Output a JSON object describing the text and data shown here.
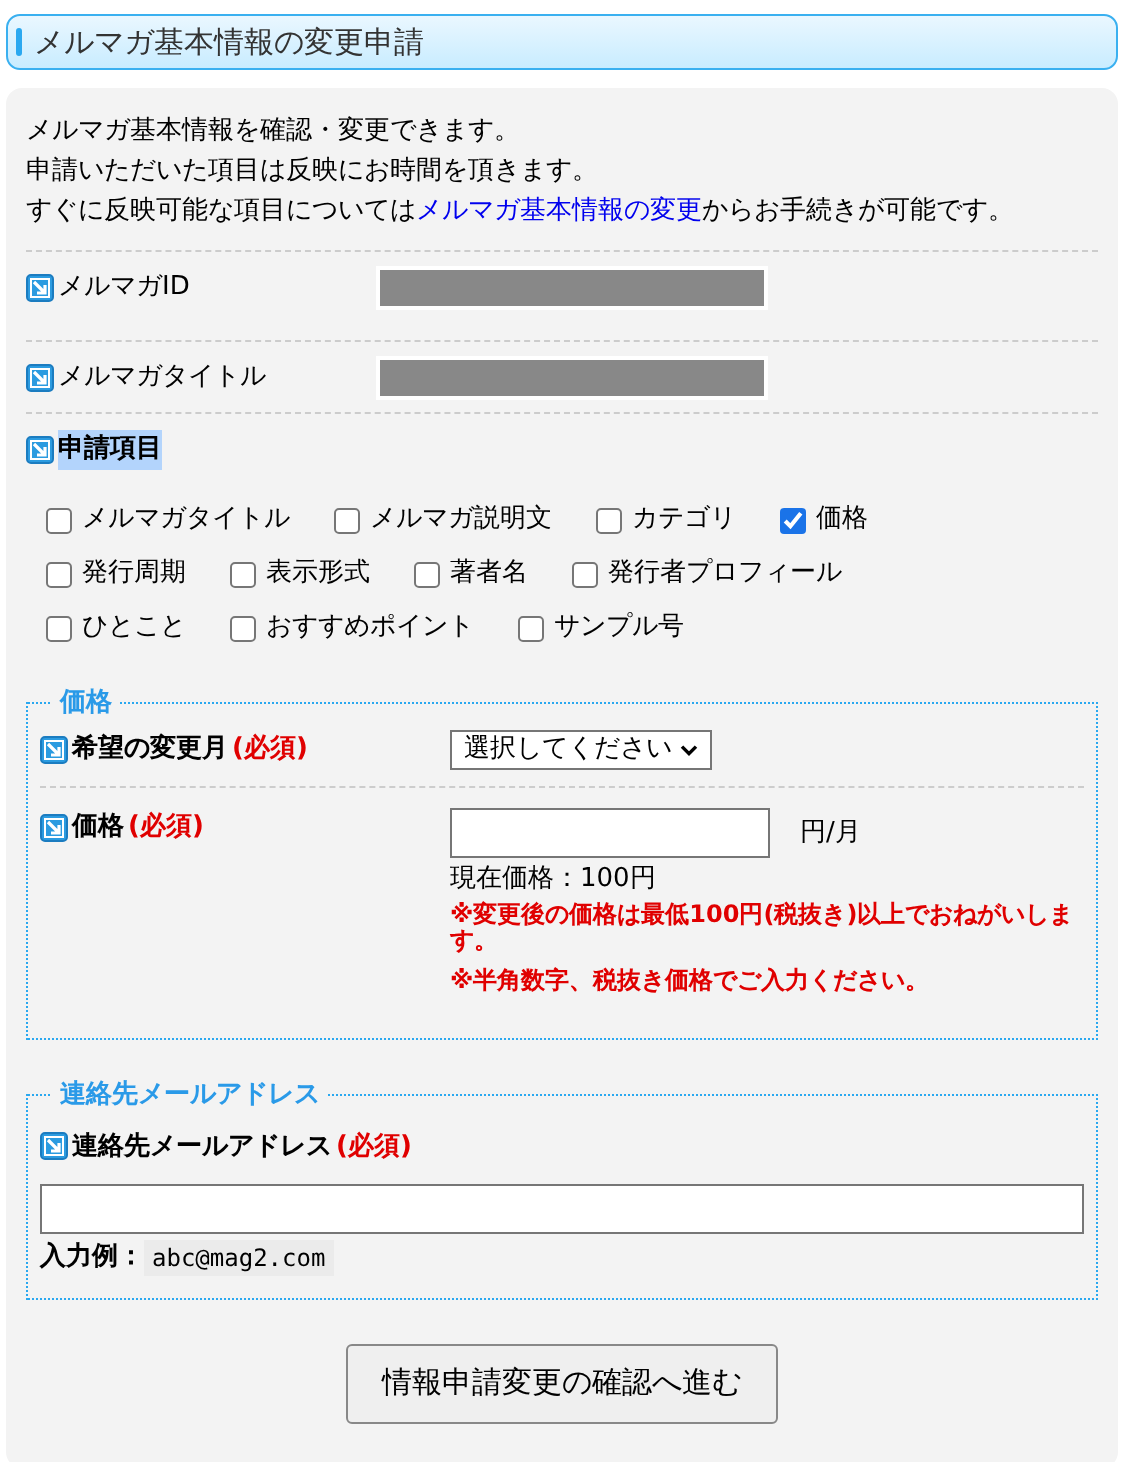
{
  "page_title": "メルマガ基本情報の変更申請",
  "intro": [
    "メルマガ基本情報を確認・変更できます。",
    "申請いただいた項目は反映にお時間を頂きます。"
  ],
  "intro_link_line": {
    "before": "すぐに反映可能な項目については",
    "link": "メルマガ基本情報の変更",
    "after": "からお手続きが可能です。"
  },
  "info_rows": [
    {
      "label": "メルマガID",
      "redacted": true
    },
    {
      "label": "メルマガタイトル",
      "redacted": true
    }
  ],
  "request_items": {
    "label": "申請項目",
    "highlighted": true,
    "rows": [
      [
        {
          "label": "メルマガタイトル",
          "checked": false
        },
        {
          "label": "メルマガ説明文",
          "checked": false
        },
        {
          "label": "カテゴリ",
          "checked": false
        },
        {
          "label": "価格",
          "checked": true
        }
      ],
      [
        {
          "label": "発行周期",
          "checked": false
        },
        {
          "label": "表示形式",
          "checked": false
        },
        {
          "label": "著者名",
          "checked": false
        },
        {
          "label": "発行者プロフィール",
          "checked": false
        }
      ],
      [
        {
          "label": "ひとこと",
          "checked": false
        },
        {
          "label": "おすすめポイント",
          "checked": false
        },
        {
          "label": "サンプル号",
          "checked": false
        }
      ]
    ]
  },
  "price_section": {
    "legend": "価格",
    "month": {
      "label": "希望の変更月",
      "required_mark": "(必須)",
      "select_value": "選択してください"
    },
    "price": {
      "label": "価格",
      "required_mark": "(必須)",
      "unit": "円/月",
      "current": "現在価格：100円",
      "notes": [
        "※変更後の価格は最低100円(税抜き)以上でおねがいします。",
        "※半角数字、税抜き価格でご入力ください。"
      ]
    }
  },
  "email_section": {
    "legend": "連絡先メールアドレス",
    "label": "連絡先メールアドレス",
    "required_mark": "(必須)",
    "example_label": "入力例：",
    "example": "abc@mag2.com"
  },
  "submit_button": "情報申請変更の確認へ進む"
}
